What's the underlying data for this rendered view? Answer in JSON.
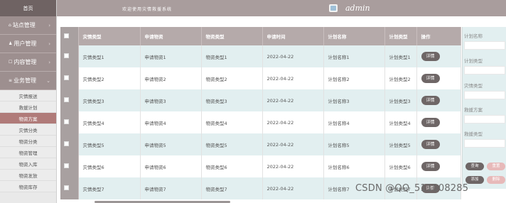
{
  "sidebar": {
    "home": "首页",
    "sections": [
      {
        "label": "站点管理"
      },
      {
        "label": "用户管理"
      },
      {
        "label": "内容管理"
      },
      {
        "label": "业务管理"
      }
    ],
    "submenu": [
      "灾情报送",
      "救援计划",
      "物资方案",
      "灾情分类",
      "物资分类",
      "物资管理",
      "物资入库",
      "物资发放",
      "物资库存"
    ],
    "active_index": 2
  },
  "header": {
    "welcome": "欢迎使用灾情救援系统",
    "user": "admin"
  },
  "table": {
    "columns": [
      "灾情类型",
      "申请物资",
      "物资类型",
      "申请时间",
      "计划名称",
      "计划类型",
      "操作"
    ],
    "detail_label": "详情",
    "rows": [
      [
        "灾情类型1",
        "申请物资1",
        "物资类型1",
        "2022-04-22",
        "计划名称1",
        "计划类型1"
      ],
      [
        "灾情类型2",
        "申请物资2",
        "物资类型2",
        "2022-04-22",
        "计划名称2",
        "计划类型2"
      ],
      [
        "灾情类型3",
        "申请物资3",
        "物资类型3",
        "2022-04-22",
        "计划名称3",
        "计划类型3"
      ],
      [
        "灾情类型4",
        "申请物资4",
        "物资类型4",
        "2022-04-22",
        "计划名称4",
        "计划类型4"
      ],
      [
        "灾情类型5",
        "申请物资5",
        "物资类型5",
        "2022-04-22",
        "计划名称5",
        "计划类型5"
      ],
      [
        "灾情类型6",
        "申请物资6",
        "物资类型6",
        "2022-04-22",
        "计划名称6",
        "计划类型6"
      ],
      [
        "灾情类型7",
        "申请物资7",
        "物资类型7",
        "2022-04-22",
        "计划名称7",
        "计划类型7"
      ]
    ]
  },
  "filters": {
    "labels": [
      "计划名称",
      "计划类型",
      "灾情类型",
      "救援方案",
      "救援类型"
    ],
    "buttons": {
      "query": "查询",
      "reset": "重置",
      "add": "添加",
      "delete": "删除"
    }
  },
  "watermark": "CSDN @QQ_511008285",
  "colors": {
    "sidebar_header": "#9d8f8f",
    "topbar": "#a99d9d",
    "row_alt": "#e2eff0",
    "button": "#6e6666",
    "active_menu": "#b07b79"
  }
}
